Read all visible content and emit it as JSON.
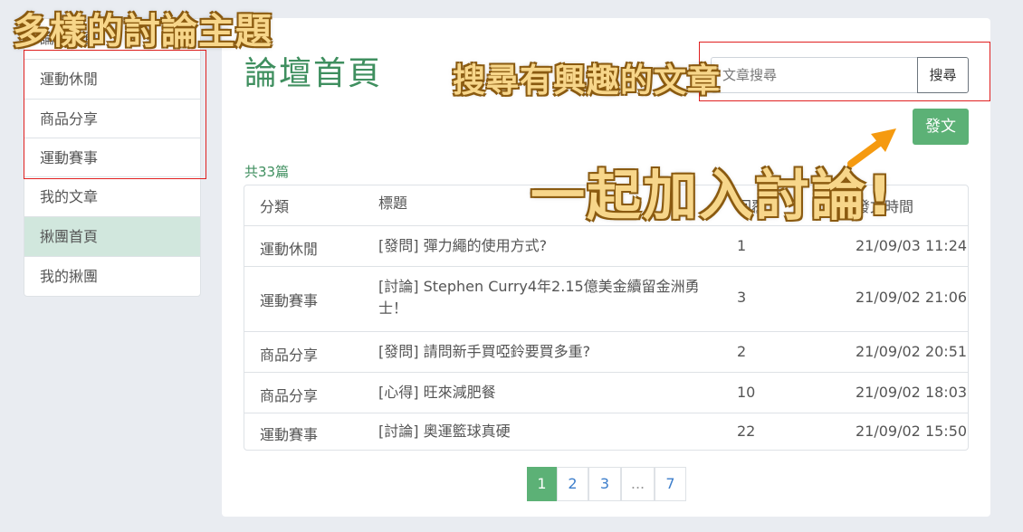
{
  "sidebar": {
    "items": [
      {
        "label": "論壇首頁",
        "active": false
      },
      {
        "label": "運動休閒",
        "active": false
      },
      {
        "label": "商品分享",
        "active": false
      },
      {
        "label": "運動賽事",
        "active": false
      },
      {
        "label": "我的文章",
        "active": false
      },
      {
        "label": "揪團首頁",
        "active": true
      },
      {
        "label": "我的揪團",
        "active": false
      }
    ]
  },
  "main": {
    "title": "論壇首頁",
    "search": {
      "placeholder": "文章搜尋",
      "button": "搜尋"
    },
    "post_button": "發文",
    "count_text": "共33篇",
    "table": {
      "headers": [
        "分類",
        "標題",
        "回覆",
        "發文時間"
      ],
      "rows": [
        {
          "category": "運動休閒",
          "title": "[發問] 彈力繩的使用方式?",
          "replies": "1",
          "time": "21/09/03 11:24"
        },
        {
          "category": "運動賽事",
          "title": "[討論] Stephen Curry4年2.15億美金續留金洲勇士！",
          "replies": "3",
          "time": "21/09/02 21:06"
        },
        {
          "category": "商品分享",
          "title": "[發問] 請問新手買啞鈴要買多重?",
          "replies": "2",
          "time": "21/09/02 20:51"
        },
        {
          "category": "商品分享",
          "title": "[心得] 旺來減肥餐",
          "replies": "10",
          "time": "21/09/02 18:03"
        },
        {
          "category": "運動賽事",
          "title": "[討論] 奧運籃球真硬",
          "replies": "22",
          "time": "21/09/02 15:50"
        }
      ]
    },
    "pagination": {
      "pages": [
        "1",
        "2",
        "3",
        "...",
        "7"
      ],
      "current": "1"
    }
  },
  "overlays": {
    "topics": "多樣的討論主題",
    "search_hint": "搜尋有興趣的文章",
    "join": "一起加入討論!"
  },
  "colors": {
    "brand_green": "#5cb176",
    "title_green": "#3f8f5f",
    "active_sidebar": "#d1e7dd",
    "annotation_red": "#e02020",
    "arrow_orange": "#f59a10"
  }
}
